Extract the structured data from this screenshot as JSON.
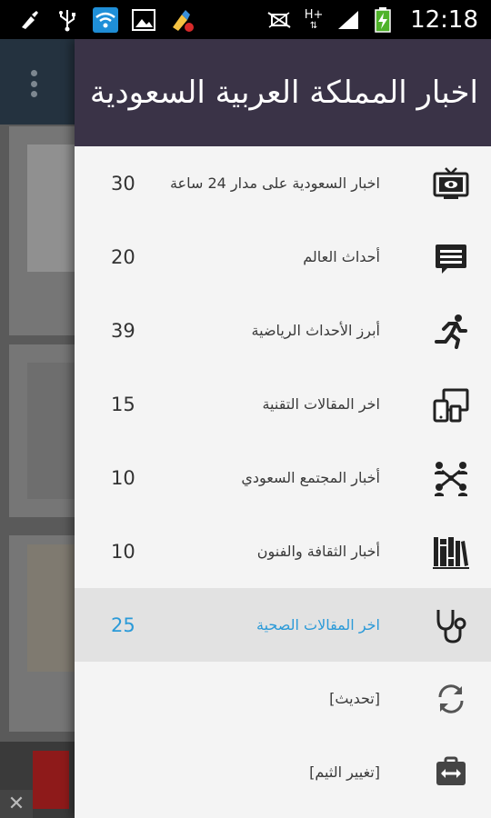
{
  "status_bar": {
    "time": "12:18",
    "network": "H+"
  },
  "drawer": {
    "title": "اخبار المملكة العربية السعودية",
    "items": [
      {
        "label": "اخبار السعودية على مدار 24 ساعة",
        "count": "30",
        "icon": "tv-icon"
      },
      {
        "label": "أحداث العالم",
        "count": "20",
        "icon": "message-icon"
      },
      {
        "label": "أبرز الأحداث الرياضية",
        "count": "39",
        "icon": "running-icon"
      },
      {
        "label": "اخر المقالات التقنية",
        "count": "15",
        "icon": "devices-icon"
      },
      {
        "label": "أخبار المجتمع السعودي",
        "count": "10",
        "icon": "people-network-icon"
      },
      {
        "label": "أخبار الثقافة والفنون",
        "count": "10",
        "icon": "books-icon"
      },
      {
        "label": "اخر المقالات الصحية",
        "count": "25",
        "icon": "stethoscope-icon",
        "active": true
      },
      {
        "label": "[تحديث]",
        "count": "",
        "icon": "refresh-icon"
      },
      {
        "label": "[تغيير الثيم]",
        "count": "",
        "icon": "swap-icon"
      }
    ]
  },
  "colors": {
    "header": "#3a3347",
    "active_text": "#2b9ad8",
    "active_bg": "#e2e2e2"
  }
}
